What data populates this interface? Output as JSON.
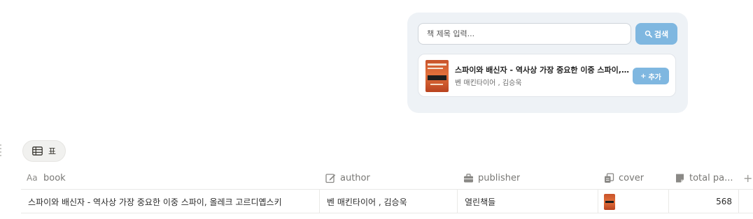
{
  "search": {
    "placeholder": "책 제목 입력...",
    "button_label": "검색"
  },
  "result": {
    "title": "스파이와 배신자 - 역사상 가장 중요한 이중 스파이, 올레크 고르디옙스키",
    "author": "벤 매킨타이어 , 김승욱",
    "add_label": "추가"
  },
  "view_tab": {
    "label": "표"
  },
  "table": {
    "headers": {
      "book_prefix": "Aa",
      "book": "book",
      "author": "author",
      "publisher": "publisher",
      "cover": "cover",
      "total_pages": "total pa..."
    },
    "rows": [
      {
        "book": "스파이와 배신자 - 역사상 가장 중요한 이중 스파이, 올레크 고르디옙스키",
        "author": "벤 매킨타이어 , 김승욱",
        "publisher": "열린책들",
        "total_pages": "568"
      }
    ],
    "add_column_icon": "+"
  },
  "colors": {
    "accent": "#7fb7e0",
    "widget_bg": "#eef2f6"
  }
}
